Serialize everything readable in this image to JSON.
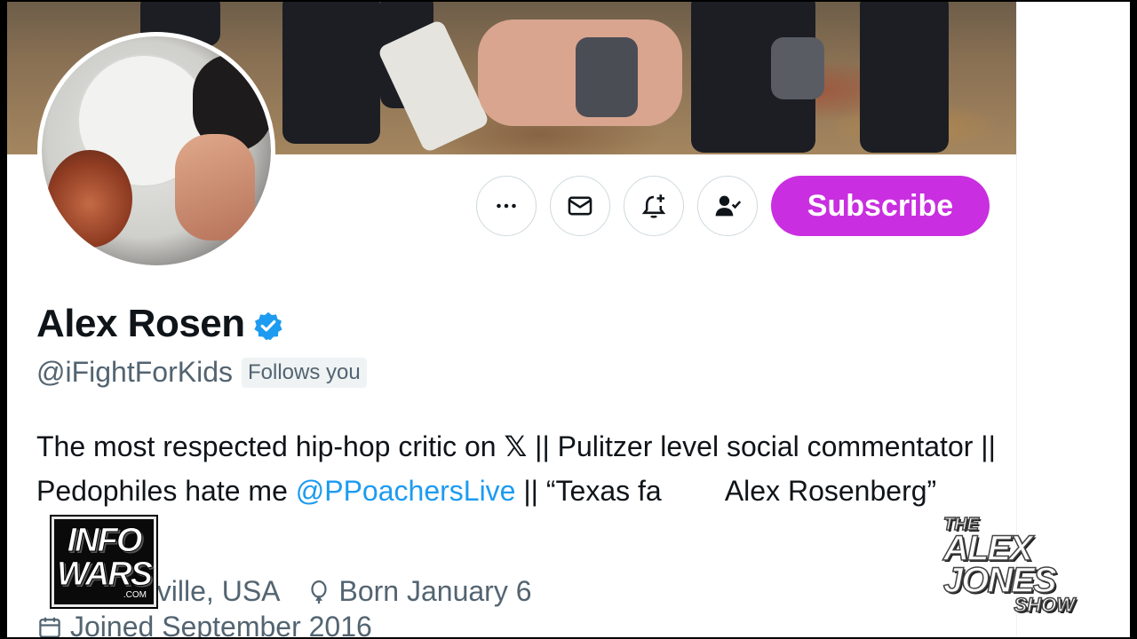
{
  "profile": {
    "name": "Alex Rosen",
    "handle": "@iFightForKids",
    "follows_badge": "Follows you",
    "bio_part1": "The most respected hip-hop critic on ",
    "bio_x": "𝕏",
    "bio_part2": " || Pulitzer level social commentator || Pedophiles hate me ",
    "bio_link": "@PPoachersLive",
    "bio_part3": " || “Texas fa",
    "bio_part4": "Alex Rosenberg”",
    "location": "dville, USA",
    "birthday": "Born January 6",
    "joined": "Joined September 2016"
  },
  "actions": {
    "more_icon": "more-icon",
    "message_icon": "mail-icon",
    "notify_icon": "bell-plus-icon",
    "following_icon": "person-check-icon",
    "subscribe_label": "Subscribe"
  },
  "overlays": {
    "infowars_line1": "INFO",
    "infowars_line2": "WARS",
    "infowars_line3": ".COM",
    "show_the": "THE",
    "show_alex": "ALEX",
    "show_jones": "JONES",
    "show_show": "SHOW"
  },
  "colors": {
    "subscribe_bg": "#c92ee0",
    "link": "#1d9bf0",
    "verified": "#1d9bf0",
    "secondary_text": "#536471"
  }
}
